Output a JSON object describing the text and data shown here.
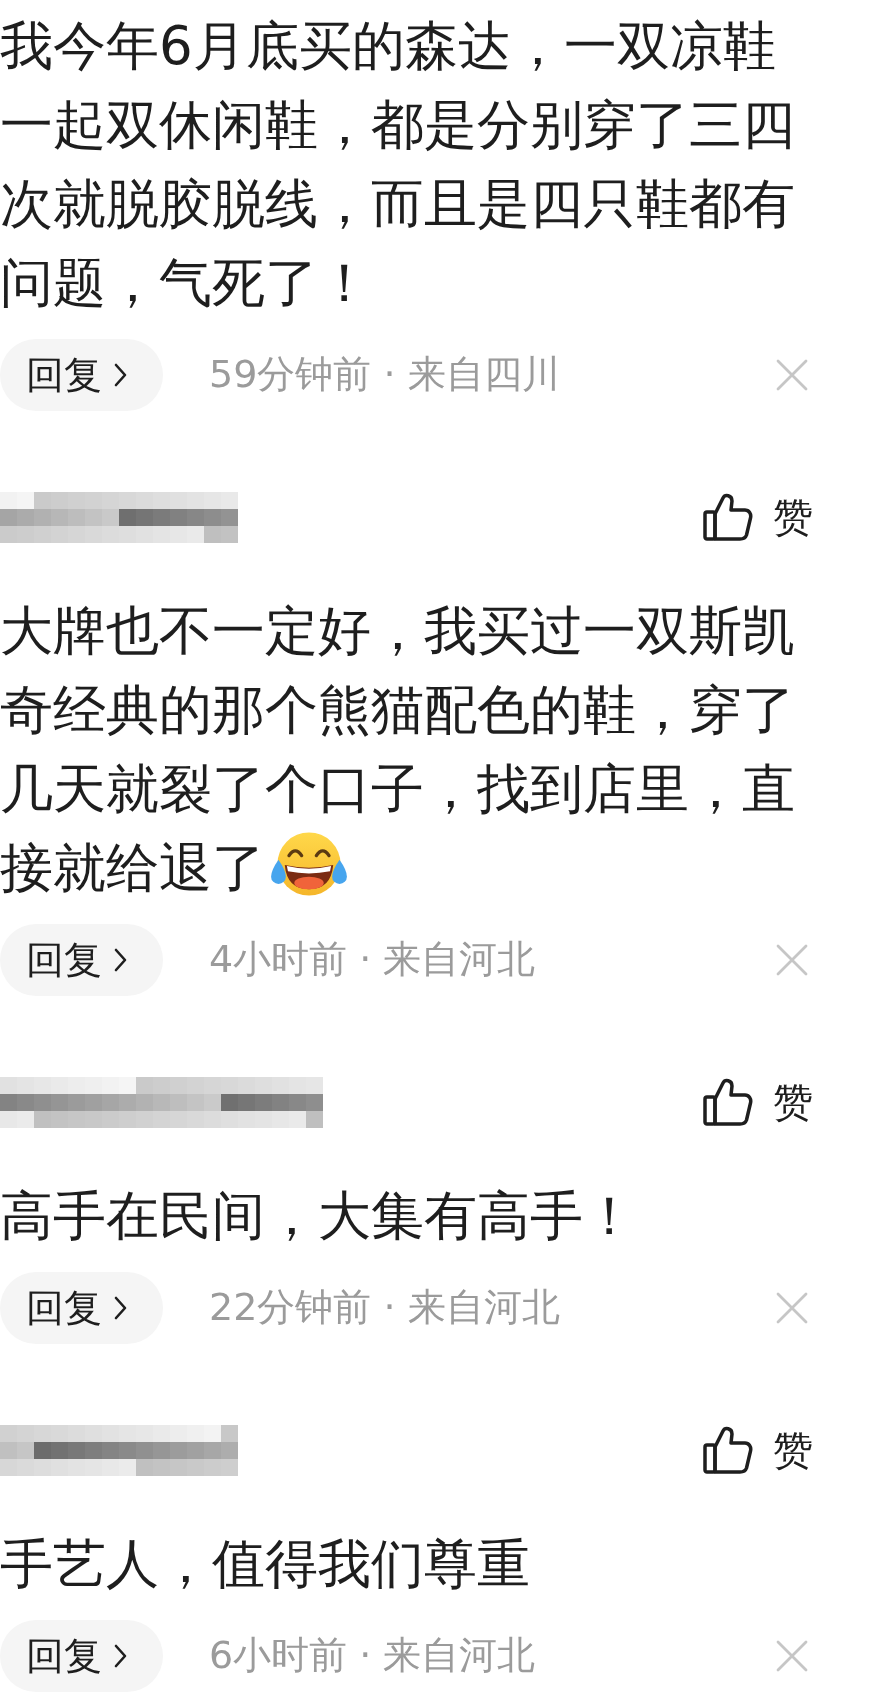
{
  "comments": [
    {
      "body": [
        {
          "kind": "text",
          "text": "我今年6月底买的森达，一双凉鞋一起双休闲鞋，都是分别穿了三四次就脱胶脱线，而且是四只鞋都有问题，气死了！"
        }
      ],
      "reply": {
        "label": "回复"
      },
      "meta": "59分钟前 · 来自四川"
    },
    {
      "author": {
        "pixelated": true
      },
      "like": {
        "label": "赞",
        "liked": false
      },
      "body": [
        {
          "kind": "text",
          "text": "大牌也不一定好，我买过一双斯凯奇经典的那个熊猫配色的鞋，穿了几天就裂了个口子，找到店里，直接就给退了"
        },
        {
          "kind": "emoji"
        }
      ],
      "reply": {
        "label": "回复"
      },
      "meta": "4小时前 · 来自河北"
    },
    {
      "author": {
        "pixelated": true
      },
      "like": {
        "label": "赞",
        "liked": false
      },
      "body": [
        {
          "kind": "text",
          "text": "高手在民间，大集有高手！"
        }
      ],
      "reply": {
        "label": "回复"
      },
      "meta": "22分钟前 · 来自河北"
    },
    {
      "author": {
        "pixelated": true
      },
      "like": {
        "label": "赞",
        "liked": false
      },
      "body": [
        {
          "kind": "text",
          "text": "手艺人，值得我们尊重"
        }
      ],
      "reply": {
        "label": "回复"
      },
      "meta": "6小时前 · 来自河北"
    }
  ]
}
